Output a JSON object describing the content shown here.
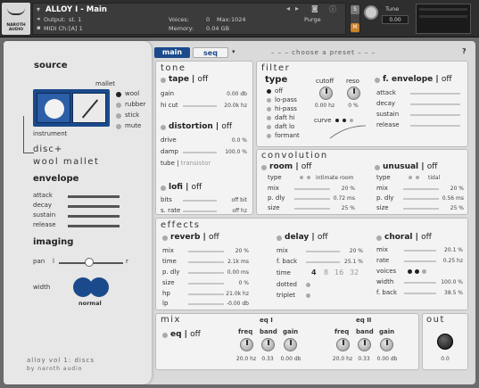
{
  "header": {
    "instrument": "ALLOY I - Main",
    "output_label": "Output:",
    "output_value": "st. 1",
    "midi_label": "MIDI Ch:",
    "midi_value": "[A] 1",
    "voices_label": "Voices:",
    "voices_value": "0",
    "max_label": "Max:",
    "max_value": "1024",
    "memory_label": "Memory:",
    "memory_value": "0.04 GB",
    "purge_label": "Purge",
    "tune_label": "Tune",
    "tune_value": "0.00",
    "logo_text": "NAROTH AUDIO"
  },
  "tabs": {
    "main": "main",
    "seq": "seq",
    "preset": "– – – choose a preset – – –",
    "help": "?"
  },
  "sidebar": {
    "source_title": "source",
    "mallet_label": "mallet",
    "instrument_label": "instrument",
    "mallets": [
      "wool",
      "rubber",
      "stick",
      "mute"
    ],
    "selected_name_1": "disc+",
    "selected_name_2": "wool mallet",
    "envelope_title": "envelope",
    "env_params": [
      "attack",
      "decay",
      "sustain",
      "release"
    ],
    "imaging_title": "imaging",
    "pan_label": "pan",
    "pan_l": "l",
    "pan_r": "r",
    "width_label": "width",
    "width_mode": "normal",
    "footer_1": "alloy vol 1: discs",
    "footer_2": "by naroth audio"
  },
  "tone": {
    "title": "tone",
    "tape": {
      "name": "tape",
      "off": "off",
      "params": [
        {
          "label": "gain",
          "value": "0.00 db"
        },
        {
          "label": "hi cut",
          "value": "20.0k hz"
        }
      ]
    },
    "distortion": {
      "name": "distortion",
      "off": "off",
      "params": [
        {
          "label": "drive",
          "value": "0.0 %"
        },
        {
          "label": "damp",
          "value": "100.0 %"
        }
      ],
      "mode_a": "tube",
      "mode_b": "transistor"
    },
    "lofi": {
      "name": "lofi",
      "off": "off",
      "params": [
        {
          "label": "bits",
          "value": "off bit"
        },
        {
          "label": "s. rate",
          "value": "off hz"
        }
      ]
    }
  },
  "filter": {
    "title": "filter",
    "type_label": "type",
    "types": [
      "off",
      "lo-pass",
      "hi-pass",
      "daft hi",
      "daft lo",
      "formant"
    ],
    "cutoff_label": "cutoff",
    "cutoff_value": "0.00 hz",
    "reso_label": "reso",
    "reso_value": "0 %",
    "curve_label": "curve",
    "fenv": {
      "name": "f. envelope",
      "off": "off",
      "params": [
        "attack",
        "decay",
        "sustain",
        "release"
      ]
    }
  },
  "convolution": {
    "title": "convolution",
    "room": {
      "name": "room",
      "off": "off",
      "type_label": "type",
      "type_value": "intimate room",
      "params": [
        {
          "label": "mix",
          "value": "20 %"
        },
        {
          "label": "p. dly",
          "value": "0.72 ms"
        },
        {
          "label": "size",
          "value": "25 %"
        }
      ]
    },
    "unusual": {
      "name": "unusual",
      "off": "off",
      "type_label": "type",
      "type_value": "tidal",
      "params": [
        {
          "label": "mix",
          "value": "20 %"
        },
        {
          "label": "p. dly",
          "value": "0.56 ms"
        },
        {
          "label": "size",
          "value": "25 %"
        }
      ]
    }
  },
  "effects": {
    "title": "effects",
    "reverb": {
      "name": "reverb",
      "off": "off",
      "params": [
        {
          "label": "mix",
          "value": "20 %"
        },
        {
          "label": "time",
          "value": "2.1k ms"
        },
        {
          "label": "p. dly",
          "value": "0.00 ms"
        },
        {
          "label": "size",
          "value": "0 %"
        },
        {
          "label": "hp",
          "value": "21.0k hz"
        },
        {
          "label": "lp",
          "value": "-0.00 db"
        }
      ]
    },
    "delay": {
      "name": "delay",
      "off": "off",
      "params": [
        {
          "label": "mix",
          "value": "20 %"
        },
        {
          "label": "f. back",
          "value": "25.1 %"
        }
      ],
      "time_label": "time",
      "times": [
        "4",
        "8",
        "16",
        "32"
      ],
      "dotted_label": "dotted",
      "triplet_label": "triplet"
    },
    "choral": {
      "name": "choral",
      "off": "off",
      "params": [
        {
          "label": "mix",
          "value": "20.1 %"
        },
        {
          "label": "rate",
          "value": "0.25 hz"
        }
      ],
      "voices_label": "voices",
      "params2": [
        {
          "label": "width",
          "value": "100.0 %"
        },
        {
          "label": "f. back",
          "value": "38.5 %"
        }
      ]
    }
  },
  "mix": {
    "title": "mix",
    "eq": {
      "name": "eq",
      "off": "off"
    },
    "eq1": {
      "title": "eq I",
      "labels": [
        "freq",
        "band",
        "gain"
      ],
      "values": [
        "20.0 hz",
        "0.33",
        "0.00 db"
      ]
    },
    "eq2": {
      "title": "eq II",
      "labels": [
        "freq",
        "band",
        "gain"
      ],
      "values": [
        "20.0 hz",
        "0.33",
        "0.00 db"
      ]
    }
  },
  "out": {
    "title": "out",
    "value": "0.0"
  },
  "colors": {
    "accent": "#1b4a8c",
    "panel": "#dadada",
    "header": "#2e2e2e"
  }
}
